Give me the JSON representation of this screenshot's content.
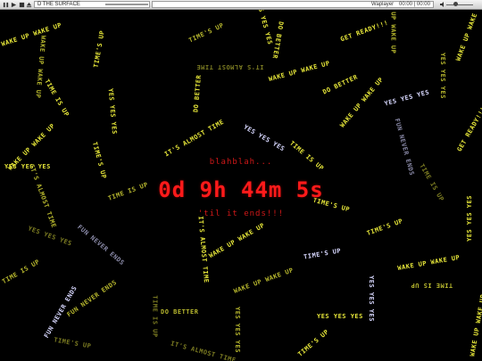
{
  "player": {
    "title": "D THE SURFACE",
    "player_name": "Waplayer",
    "time": "00:00 | 00:00",
    "progress": 0,
    "volume": 0.45,
    "icons": [
      "pause-icon",
      "play-icon",
      "stop-icon",
      "volume-icon"
    ]
  },
  "countdown": {
    "before_label": "blahblah...",
    "timer": "0d 9h 44m 5s",
    "after_label": "'til it ends!!!"
  },
  "colors": {
    "background": "#000000",
    "word_yellow": "#e8e83a",
    "word_white": "#d8d8ff",
    "countdown_red": "#ff1a1a"
  },
  "floating_words": [
    "YES YES YES",
    "WAKE UP WAKE UP",
    "GET READY!!!",
    "IT'S ALMOST TIME",
    "TIME'S UP",
    "FUN NEVER ENDS",
    "DO BETTER",
    "TIME IS UP",
    "IT'S ALMOST TIME",
    "TIME'S UP"
  ]
}
